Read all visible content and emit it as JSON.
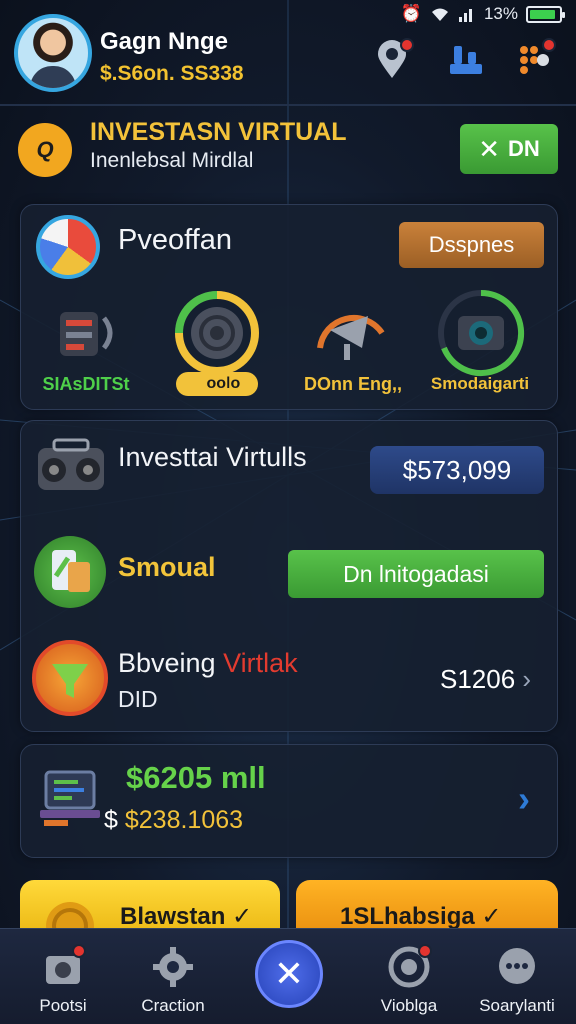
{
  "status_bar": {
    "battery_text": "13%",
    "battery_level": 0.9
  },
  "header": {
    "user_name": "Gagn Nnge",
    "balance": "$.S6on. SS338"
  },
  "banner": {
    "logo_text": "Q",
    "title": "INVESTASN VIRTUAL",
    "subtitle": "Inenlebsal Mirdlal",
    "button_label": "DN"
  },
  "panel_1": {
    "title": "Pveoffan",
    "action_label": "Dsspnes",
    "gauges": [
      {
        "label": "SIAsDITSt",
        "color": "#4fd04a",
        "level": 0.0
      },
      {
        "label": "ooǀo",
        "color": "#1a1a1a",
        "level": 0.75
      },
      {
        "label": "DOnn Eng,,",
        "color": "#f2c23a",
        "level": 0.45
      },
      {
        "label": "Smodaigarti",
        "color": "#f2c23a",
        "level": 0.85
      }
    ]
  },
  "panel_2": {
    "row_1": {
      "title": "Investtai Virtulls",
      "value": "$573,099"
    },
    "row_2": {
      "title": "Smoual",
      "button_label": "Dn lnitogadasi"
    },
    "row_3": {
      "title_a": "Bbveing",
      "title_b": "Virtlak",
      "subtitle": "DID",
      "value": "S1206"
    }
  },
  "panel_3": {
    "value": "$6205 mll",
    "sub_prefix": "$",
    "sub_value": "$238.1063"
  },
  "cards": {
    "left_label": "Blawstan",
    "right_label": "1SLhabsiga"
  },
  "nav": {
    "items": [
      {
        "label": "Pootsi"
      },
      {
        "label": "Craction"
      },
      {
        "label": "Vioblga"
      },
      {
        "label": "Soarylanti"
      }
    ]
  },
  "colors": {
    "accent_green": "#4fb33f",
    "accent_yellow": "#f2c23a",
    "accent_blue": "#36a6e0",
    "alert_red": "#e3342f"
  }
}
